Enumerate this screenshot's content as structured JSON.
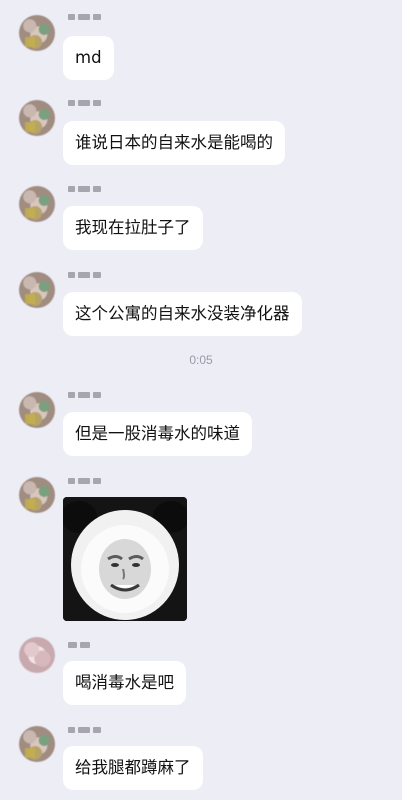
{
  "messages": [
    {
      "sender": "nickname",
      "text": "md"
    },
    {
      "sender": "nickname",
      "text": "谁说日本的自来水是能喝的"
    },
    {
      "sender": "nickname",
      "text": "我现在拉肚子了"
    },
    {
      "sender": "nickname",
      "text": "这个公寓的自来水没装净化器"
    },
    {
      "sender": "nickname",
      "text": "但是一股消毒水的味道"
    },
    {
      "sender": "nickname",
      "type": "sticker",
      "sticker": "panda-face-meme"
    },
    {
      "sender": "nickname",
      "text": "喝消毒水是吧"
    },
    {
      "sender": "nickname",
      "text": "给我腿都蹲麻了"
    }
  ],
  "timestamp": "0:05",
  "colors": {
    "background": "#ededf6",
    "bubble": "#ffffff",
    "text": "#111111",
    "timestamp": "#9a9aa5"
  }
}
